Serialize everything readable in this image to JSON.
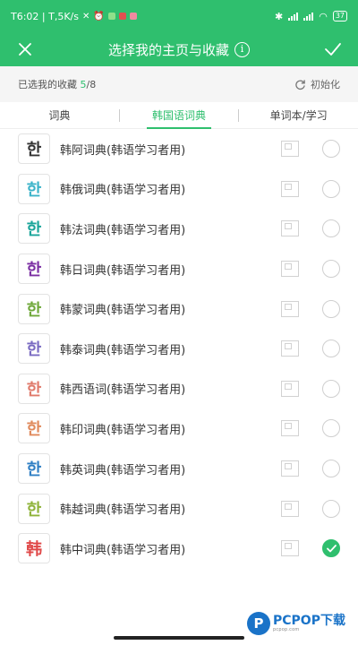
{
  "status_bar": {
    "time_speed": "T6:02 | T,5K/s",
    "battery": "37"
  },
  "app_bar": {
    "title": "选择我的主页与收藏",
    "info_symbol": "i"
  },
  "summary": {
    "label": "已选我的收藏",
    "selected": "5",
    "separator": "/",
    "total": "8",
    "reset_label": "初始化"
  },
  "tabs": [
    {
      "label": "词典"
    },
    {
      "label": "韩国语词典",
      "active": true
    },
    {
      "label": "单词本/学习"
    }
  ],
  "dictionaries": [
    {
      "badge": "한",
      "color": "#333333",
      "label": "韩阿词典(韩语学习者用)",
      "checked": false
    },
    {
      "badge": "한",
      "color": "#3bb3c9",
      "label": "韩俄词典(韩语学习者用)",
      "checked": false
    },
    {
      "badge": "한",
      "color": "#1aa59a",
      "label": "韩法词典(韩语学习者用)",
      "checked": false
    },
    {
      "badge": "한",
      "color": "#7b2fa3",
      "label": "韩日词典(韩语学习者用)",
      "checked": false
    },
    {
      "badge": "한",
      "color": "#6fa83a",
      "label": "韩蒙词典(韩语学习者用)",
      "checked": false
    },
    {
      "badge": "한",
      "color": "#7a6bc2",
      "label": "韩泰词典(韩语学习者用)",
      "checked": false
    },
    {
      "badge": "한",
      "color": "#e07a6b",
      "label": "韩西语词(韩语学习者用)",
      "checked": false
    },
    {
      "badge": "한",
      "color": "#e08a5c",
      "label": "韩印词典(韩语学习者用)",
      "checked": false
    },
    {
      "badge": "한",
      "color": "#2f7fc4",
      "label": "韩英词典(韩语学习者用)",
      "checked": false
    },
    {
      "badge": "한",
      "color": "#8fb33a",
      "label": "韩越词典(韩语学习者用)",
      "checked": false
    },
    {
      "badge": "韩",
      "color": "#e04848",
      "label": "韩中词典(韩语学习者用)",
      "checked": true
    }
  ],
  "watermark": {
    "logo_letter": "P",
    "brand": "PCPOP下载"
  }
}
